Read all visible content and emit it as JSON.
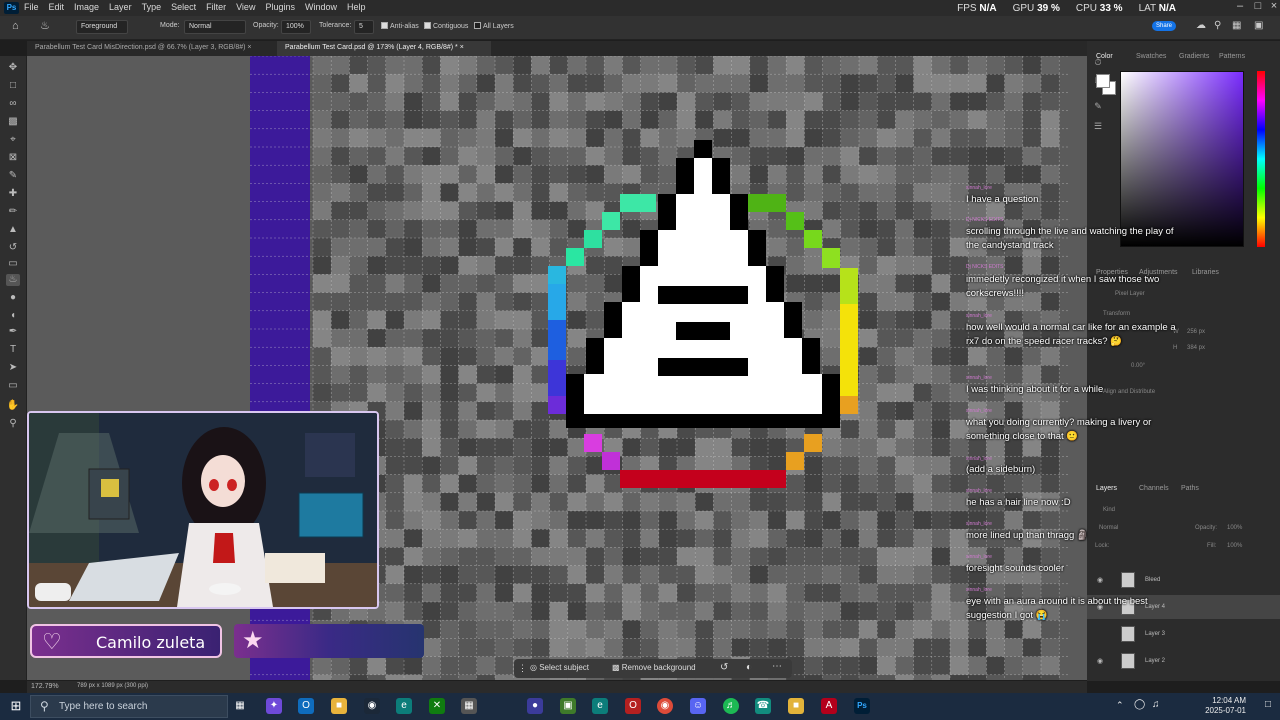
{
  "menubar": {
    "logo": "Ps",
    "items": [
      "File",
      "Edit",
      "Image",
      "Layer",
      "Type",
      "Select",
      "Filter",
      "View",
      "Plugins",
      "Window",
      "Help"
    ],
    "fps_label": "FPS",
    "fps_value": "N/A",
    "gpu_label": "GPU",
    "gpu_value": "39 %",
    "cpu_label": "CPU",
    "cpu_value": "33 %",
    "lat_label": "LAT",
    "lat_value": "N/A",
    "share": "Share"
  },
  "options": {
    "preset": "Foreground",
    "mode_label": "Mode:",
    "mode_value": "Normal",
    "opacity_label": "Opacity:",
    "opacity_value": "100%",
    "tolerance_label": "Tolerance:",
    "tolerance_value": "5",
    "antialias": "Anti-alias",
    "contiguous": "Contiguous",
    "all_layers": "All Layers"
  },
  "tabs": [
    {
      "label": "Parabellum Test Card MisDirection.psd @ 66.7% (Layer 3, RGB/8#)"
    },
    {
      "label": "Parabellum Test Card.psd @ 173% (Layer 4, RGB/8#) *"
    }
  ],
  "context_bar": {
    "select_subject": "Select subject",
    "remove_background": "Remove background"
  },
  "status": {
    "zoom": "172.79%",
    "doc_size": "789 px x 1089 px (300 ppi)"
  },
  "color_panel": {
    "tabs": [
      "Color",
      "Swatches",
      "Gradients",
      "Patterns"
    ],
    "accent": "#7a2cff"
  },
  "properties_panel": {
    "tabs": [
      "Properties",
      "Adjustments",
      "Libraries"
    ],
    "kind": "Pixel Layer",
    "transform": "Transform",
    "w": "W",
    "w_value": "256 px",
    "h": "H",
    "h_value": "384 px",
    "angle": "0.00°",
    "align": "Align and Distribute"
  },
  "layers_panel": {
    "tabs": [
      "Layers",
      "Channels",
      "Paths"
    ],
    "kind": "Kind",
    "mode": "Normal",
    "opacity_label": "Opacity:",
    "opacity_value": "100%",
    "lock_label": "Lock:",
    "fill_label": "Fill:",
    "fill_value": "100%",
    "layers": [
      "Bleed",
      "Layer 4",
      "Layer 3",
      "Layer 2"
    ]
  },
  "chat": {
    "messages": [
      {
        "user": "sinnah_lore",
        "text": "I have a question"
      },
      {
        "user": "Dj NICKS EDITS",
        "text": "scrolling through the live and watching the play of the candystand track"
      },
      {
        "user": "Dj NICKS EDITS",
        "text": "immedetly recongized it when I saw those two corkscrews!!!!"
      },
      {
        "user": "sinnah_lore",
        "text": "how well would a normal car like for an example a rx7 do on the speed racer tracks? 🤔"
      },
      {
        "user": "sinnah_lore",
        "text": "I was thinking about it for a while"
      },
      {
        "user": "sinnah_lore",
        "text": "what you doing currently? making a livery or something close to that 🙂"
      },
      {
        "user": "sinnah_lore",
        "text": "(add a sideburn)"
      },
      {
        "user": "sinnah_lore",
        "text": "he has a hair line now :D"
      },
      {
        "user": "sinnah_lore",
        "text": "more lined up than thragg 🗿"
      },
      {
        "user": "sinnah_lore",
        "text": "foresight sounds cooler"
      },
      {
        "user": "sinnah_lore",
        "text": "eye with an aura around it is about the best suggestion I got 😭"
      }
    ]
  },
  "overlay": {
    "name": "Camilo zuleta"
  },
  "taskbar": {
    "search_placeholder": "Type here to search",
    "time": "12:04 AM",
    "date": "2025-07-01"
  }
}
